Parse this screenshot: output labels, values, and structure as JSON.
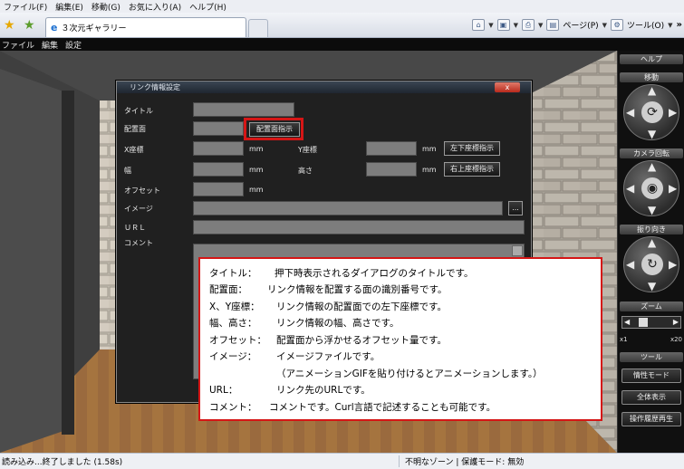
{
  "browser": {
    "menu": [
      "ファイル(F)",
      "編集(E)",
      "移動(G)",
      "お気に入り(A)",
      "ヘルプ(H)"
    ],
    "tab_title": "３次元ギャラリー",
    "commands": {
      "page": "ページ(P)",
      "tools": "ツール(O)"
    }
  },
  "app_menu": [
    "ファイル",
    "編集",
    "設定"
  ],
  "panel": {
    "help": "ヘルプ",
    "move": "移動",
    "camera": "カメラ回転",
    "turn": "振り向き",
    "zoom": "ズーム",
    "zoom_min": "x1",
    "zoom_max": "x20",
    "tools": "ツール",
    "btn_edit_mode": "情性モード",
    "btn_show_all": "全体表示",
    "btn_replay": "操作履歴再生"
  },
  "dialog": {
    "title": "リンク情報設定",
    "close": "x",
    "labels": {
      "title": "タイトル",
      "face": "配置面",
      "x": "X座標",
      "y": "Y座標",
      "width": "幅",
      "height": "高さ",
      "offset": "オフセット",
      "image": "イメージ",
      "url": "ＵＲＬ",
      "comment": "コメント"
    },
    "unit": "mm",
    "buttons": {
      "face_pick": "配置面指示",
      "bottom_left": "左下座標指示",
      "top_right": "右上座標指示",
      "browse": "..."
    }
  },
  "callout": [
    {
      "k": "タイトル：",
      "v": "押下時表示されるダイアログのタイトルです。"
    },
    {
      "k": "配置面：",
      "v": "リンク情報を配置する面の識別番号です。"
    },
    {
      "k": "X、Y座標：",
      "v": "リンク情報の配置面での左下座標です。"
    },
    {
      "k": "幅、高さ：",
      "v": "リンク情報の幅、高さです。"
    },
    {
      "k": "オフセット：",
      "v": "配置面から浮かせるオフセット量です。"
    },
    {
      "k": "イメージ：",
      "v": "イメージファイルです。"
    },
    {
      "k": "",
      "v": "（アニメーションGIFを貼り付けるとアニメーションします。）"
    },
    {
      "k": "URL：",
      "v": "リンク先のURLです。"
    },
    {
      "k": "コメント：",
      "v": "コメントです。Curl言語で記述することも可能です。"
    }
  ],
  "status": {
    "left": "読み込み...終了しました (1.58s)",
    "right": "不明なゾーン | 保護モード: 無効"
  }
}
